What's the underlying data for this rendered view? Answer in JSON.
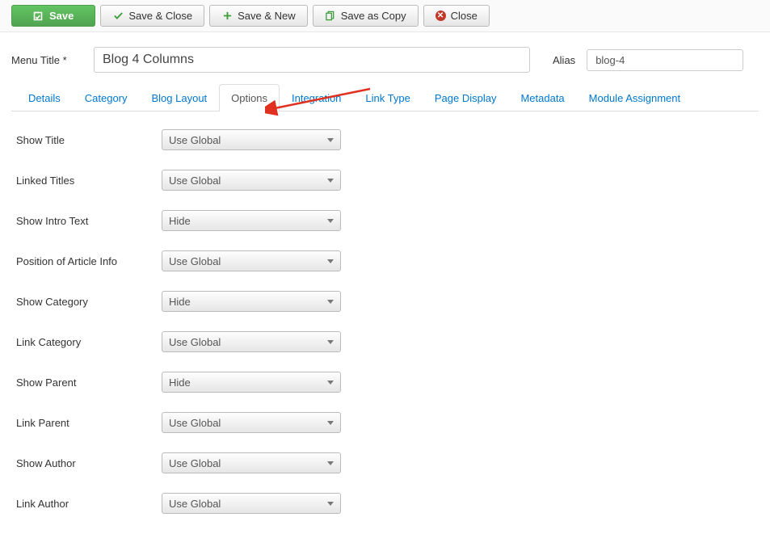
{
  "toolbar": {
    "save": "Save",
    "save_close": "Save & Close",
    "save_new": "Save & New",
    "save_copy": "Save as Copy",
    "close": "Close"
  },
  "form": {
    "menu_title_label": "Menu Title *",
    "menu_title_value": "Blog 4 Columns",
    "alias_label": "Alias",
    "alias_value": "blog-4"
  },
  "tabs": [
    {
      "label": "Details",
      "active": false
    },
    {
      "label": "Category",
      "active": false
    },
    {
      "label": "Blog Layout",
      "active": false
    },
    {
      "label": "Options",
      "active": true
    },
    {
      "label": "Integration",
      "active": false
    },
    {
      "label": "Link Type",
      "active": false
    },
    {
      "label": "Page Display",
      "active": false
    },
    {
      "label": "Metadata",
      "active": false
    },
    {
      "label": "Module Assignment",
      "active": false
    }
  ],
  "options": [
    {
      "label": "Show Title",
      "value": "Use Global"
    },
    {
      "label": "Linked Titles",
      "value": "Use Global"
    },
    {
      "label": "Show Intro Text",
      "value": "Hide"
    },
    {
      "label": "Position of Article Info",
      "value": "Use Global"
    },
    {
      "label": "Show Category",
      "value": "Hide"
    },
    {
      "label": "Link Category",
      "value": "Use Global"
    },
    {
      "label": "Show Parent",
      "value": "Hide"
    },
    {
      "label": "Link Parent",
      "value": "Use Global"
    },
    {
      "label": "Show Author",
      "value": "Use Global"
    },
    {
      "label": "Link Author",
      "value": "Use Global"
    }
  ]
}
